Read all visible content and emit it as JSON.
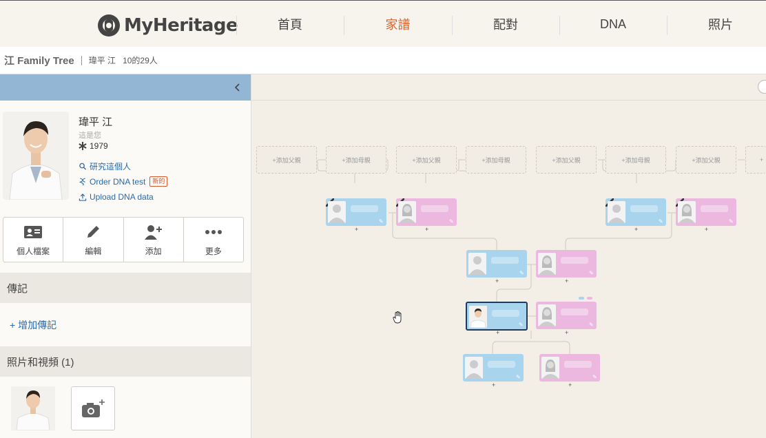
{
  "nav": {
    "logo": "MyHeritage",
    "items": [
      {
        "label": "首頁"
      },
      {
        "label": "家譜"
      },
      {
        "label": "配對"
      },
      {
        "label": "DNA"
      },
      {
        "label": "照片"
      }
    ],
    "active_color": "#d9622b"
  },
  "breadcrumb": {
    "tree_name": "江 Family Tree",
    "owner": "瑋平 江",
    "count": "10的29人"
  },
  "profile": {
    "name": "瑋平 江",
    "relation": "這是您",
    "birth_year": "1979",
    "links": {
      "research": "研究這個人",
      "order_dna": "Order DNA test",
      "new_badge": "新的",
      "upload_dna": "Upload DNA data"
    },
    "actions": {
      "profile": "個人檔案",
      "edit": "編輯",
      "add": "添加",
      "more": "更多"
    }
  },
  "sections": {
    "bio": "傳記",
    "add_bio": "+ 增加傳記",
    "media": "照片和視頻 (1)"
  },
  "tree": {
    "add_father": "+添加父親",
    "add_mother": "+添加母親",
    "male_color": "#a8d4ee",
    "female_color": "#ecb8df"
  }
}
